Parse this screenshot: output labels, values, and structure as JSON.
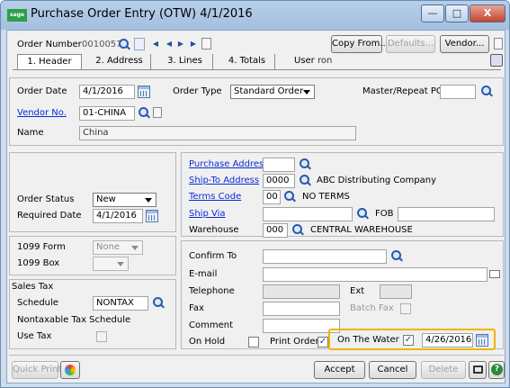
{
  "window": {
    "title": "Purchase Order Entry (OTW) 4/1/2016",
    "logo_text": "sage",
    "min_symbol": "—",
    "max_symbol": "□",
    "close_symbol": "X"
  },
  "header": {
    "order_number_label": "Order Number",
    "order_number_value": "0010057",
    "copy_from_label": "Copy From...",
    "defaults_label": "Defaults...",
    "vendor_button_label": "Vendor...",
    "user_label": "User",
    "user_value": "ron"
  },
  "tabs": [
    {
      "label": "1. Header"
    },
    {
      "label": "2. Address"
    },
    {
      "label": "3. Lines"
    },
    {
      "label": "4. Totals"
    }
  ],
  "order": {
    "order_date_label": "Order Date",
    "order_date_value": "4/1/2016",
    "order_type_label": "Order Type",
    "order_type_value": "Standard Order",
    "master_repeat_label": "Master/Repeat PO",
    "vendor_no_label": "Vendor No.",
    "vendor_no_value": "01-CHINA",
    "name_label": "Name",
    "name_value": "China"
  },
  "status": {
    "order_status_label": "Order Status",
    "order_status_value": "New",
    "required_date_label": "Required Date",
    "required_date_value": "4/1/2016"
  },
  "form1099": {
    "form_label": "1099 Form",
    "form_value": "None",
    "box_label": "1099 Box"
  },
  "sales_tax": {
    "section_label": "Sales Tax",
    "schedule_label": "Schedule",
    "schedule_value": "NONTAX",
    "schedule_desc": "Nontaxable Tax Schedule",
    "use_tax_label": "Use Tax"
  },
  "address": {
    "purchase_address_label": "Purchase Address",
    "ship_to_label": "Ship-To Address",
    "ship_to_code": "0000",
    "ship_to_name": "ABC Distributing Company",
    "terms_label": "Terms Code",
    "terms_code": "00",
    "terms_desc": "NO TERMS",
    "ship_via_label": "Ship Via",
    "fob_label": "FOB",
    "warehouse_label": "Warehouse",
    "warehouse_code": "000",
    "warehouse_desc": "CENTRAL WAREHOUSE"
  },
  "contact": {
    "confirm_to_label": "Confirm To",
    "email_label": "E-mail",
    "telephone_label": "Telephone",
    "ext_label": "Ext",
    "fax_label": "Fax",
    "batch_fax_label": "Batch Fax",
    "comment_label": "Comment",
    "on_hold_label": "On Hold",
    "print_order_label": "Print Order",
    "print_order_checked": "✓",
    "on_the_water_label": "On The Water",
    "on_the_water_checked": "✓",
    "on_the_water_date": "4/26/2016"
  },
  "footer": {
    "quick_print_label": "Quick Print...",
    "accept_label": "Accept",
    "cancel_label": "Cancel",
    "delete_label": "Delete"
  },
  "colors": {
    "titlebar": "#b6cfe9",
    "link": "#0a2bd6",
    "highlight": "#f0b400"
  }
}
